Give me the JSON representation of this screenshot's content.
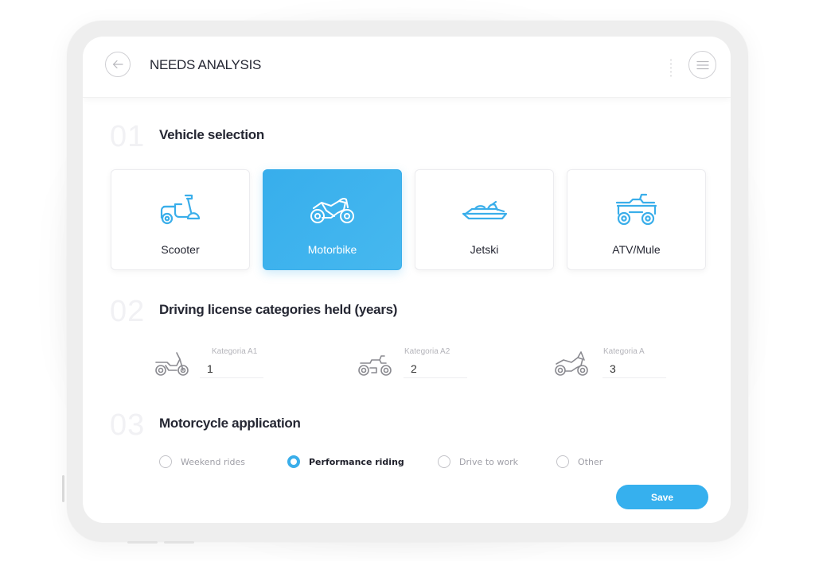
{
  "header": {
    "title": "NEEDS ANALYSIS",
    "back_icon": "arrow-left-icon",
    "menu_icon": "hamburger-menu-icon"
  },
  "sections": [
    {
      "number": "01",
      "title": "Vehicle selection"
    },
    {
      "number": "02",
      "title": "Driving license categories held (years)"
    },
    {
      "number": "03",
      "title": "Motorcycle application"
    }
  ],
  "vehicles": [
    {
      "label": "Scooter",
      "icon": "scooter-icon",
      "selected": false
    },
    {
      "label": "Motorbike",
      "icon": "motorbike-icon",
      "selected": true
    },
    {
      "label": "Jetski",
      "icon": "jetski-icon",
      "selected": false
    },
    {
      "label": "ATV/Mule",
      "icon": "atv-icon",
      "selected": false
    }
  ],
  "licenses": [
    {
      "label": "Kategoria A1",
      "value": "1",
      "icon": "dirt-bike-icon"
    },
    {
      "label": "Kategoria A2",
      "value": "2",
      "icon": "classic-motorcycle-icon"
    },
    {
      "label": "Kategoria A",
      "value": "3",
      "icon": "sport-motorcycle-icon"
    }
  ],
  "applications": [
    {
      "label": "Weekend rides",
      "checked": false
    },
    {
      "label": "Performance riding",
      "checked": true
    },
    {
      "label": "Drive to work",
      "checked": false
    },
    {
      "label": "Other",
      "checked": false
    }
  ],
  "save_label": "Save",
  "colors": {
    "accent": "#36b0ee",
    "text_dark": "#252733",
    "text_muted": "#9e9ea6"
  }
}
